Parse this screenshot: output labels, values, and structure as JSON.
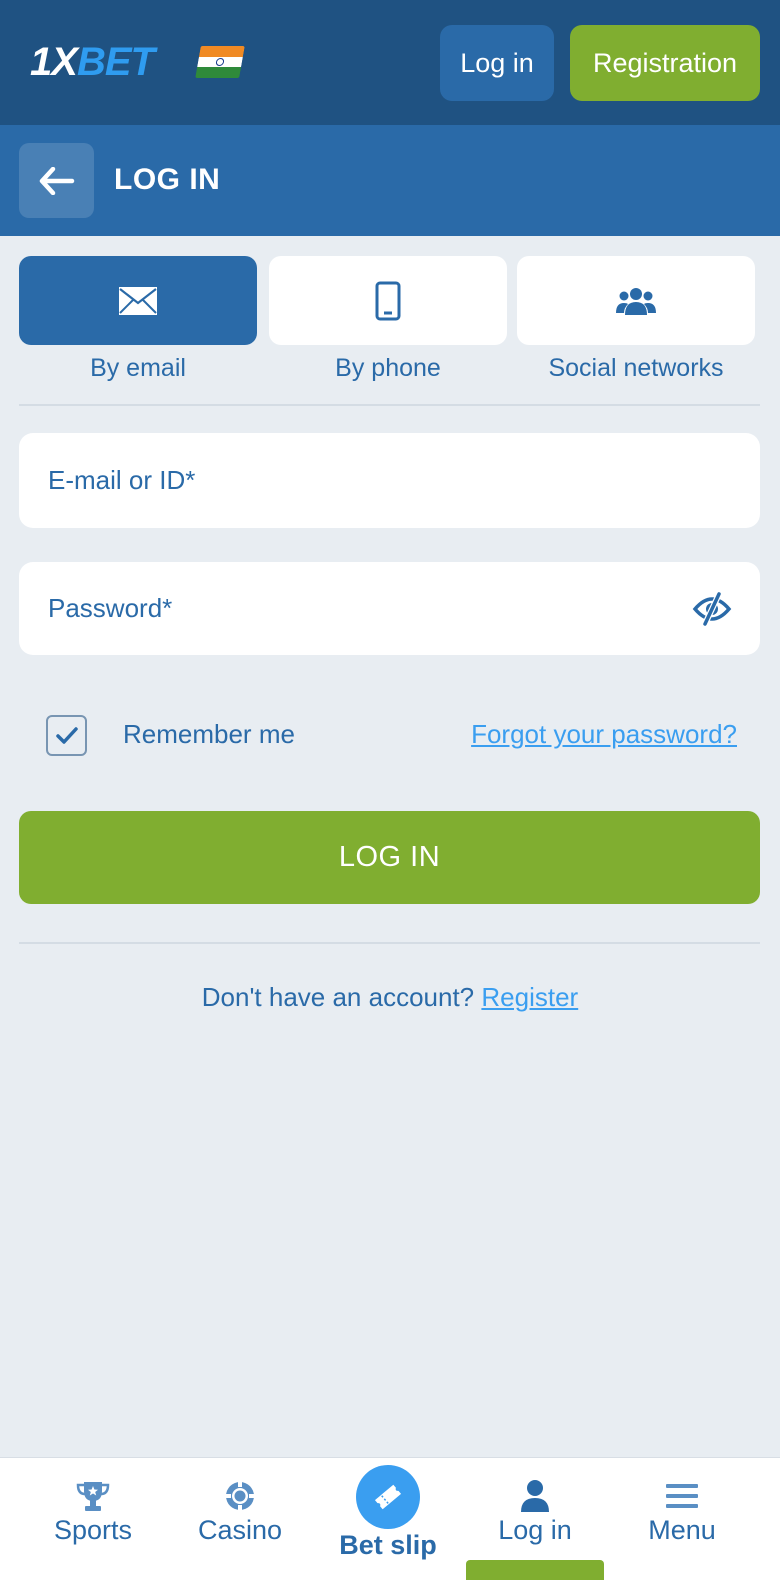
{
  "header": {
    "logo_part1": "1X",
    "logo_part2": "BET",
    "login_label": "Log in",
    "registration_label": "Registration"
  },
  "subheader": {
    "title": "LOG IN"
  },
  "tabs": [
    {
      "label": "By email",
      "icon": "envelope-icon",
      "active": true
    },
    {
      "label": "By phone",
      "icon": "phone-icon",
      "active": false
    },
    {
      "label": "Social networks",
      "icon": "users-icon",
      "active": false
    }
  ],
  "form": {
    "email_placeholder": "E-mail or ID*",
    "email_value": "",
    "password_placeholder": "Password*",
    "password_value": "",
    "remember_label": "Remember me",
    "remember_checked": true,
    "forgot_label": "Forgot your password?",
    "submit_label": "LOG IN"
  },
  "register_prompt": {
    "text": "Don't have an account?",
    "link": "Register"
  },
  "bottom_nav": [
    {
      "label": "Sports",
      "icon": "trophy-icon"
    },
    {
      "label": "Casino",
      "icon": "casino-chip-icon"
    },
    {
      "label": "Bet slip",
      "icon": "ticket-icon"
    },
    {
      "label": "Log in",
      "icon": "user-icon",
      "active": true
    },
    {
      "label": "Menu",
      "icon": "menu-icon"
    }
  ],
  "colors": {
    "header_bg": "#1f5282",
    "subheader_bg": "#2a6aa8",
    "accent_green": "#80ae30",
    "link_blue": "#3a9ef0",
    "page_bg": "#e8edf2"
  }
}
